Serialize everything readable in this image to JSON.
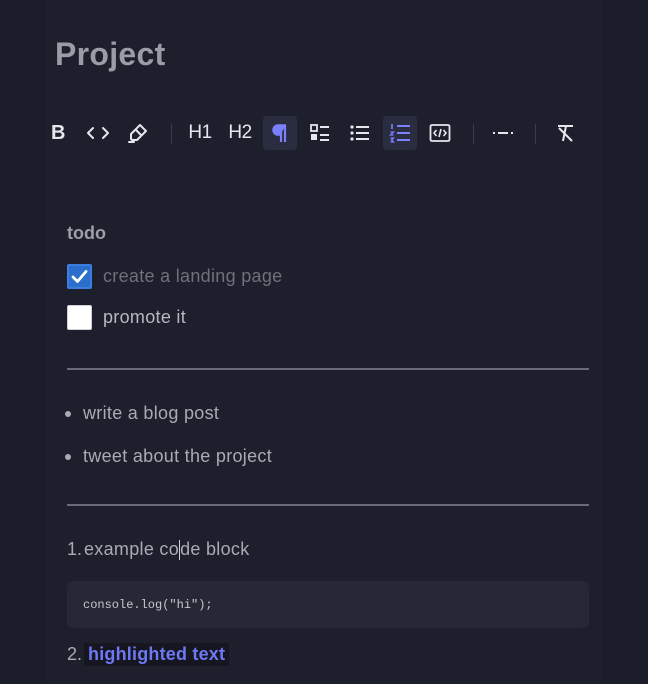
{
  "document": {
    "title": "Project"
  },
  "toolbar": {
    "bold": "B",
    "h1": "H1",
    "h2": "H2"
  },
  "todo": {
    "heading": "todo",
    "items": [
      {
        "label": "create a landing page",
        "checked": true
      },
      {
        "label": "promote it",
        "checked": false
      }
    ]
  },
  "bullets": {
    "items": [
      "write a blog post",
      "tweet about the project"
    ]
  },
  "ordered": {
    "items": [
      {
        "number": "1.",
        "text_before_caret": "example co",
        "text_after_caret": "de block"
      },
      {
        "number": "2.",
        "text": "highlighted text"
      }
    ]
  },
  "code_block": {
    "code": "console.log(\"hi\");"
  },
  "colors": {
    "background": "#1e1f2c",
    "accent": "#7b80ff",
    "checkbox_checked": "#2c6ecb",
    "highlight_text": "#6f78f4"
  }
}
